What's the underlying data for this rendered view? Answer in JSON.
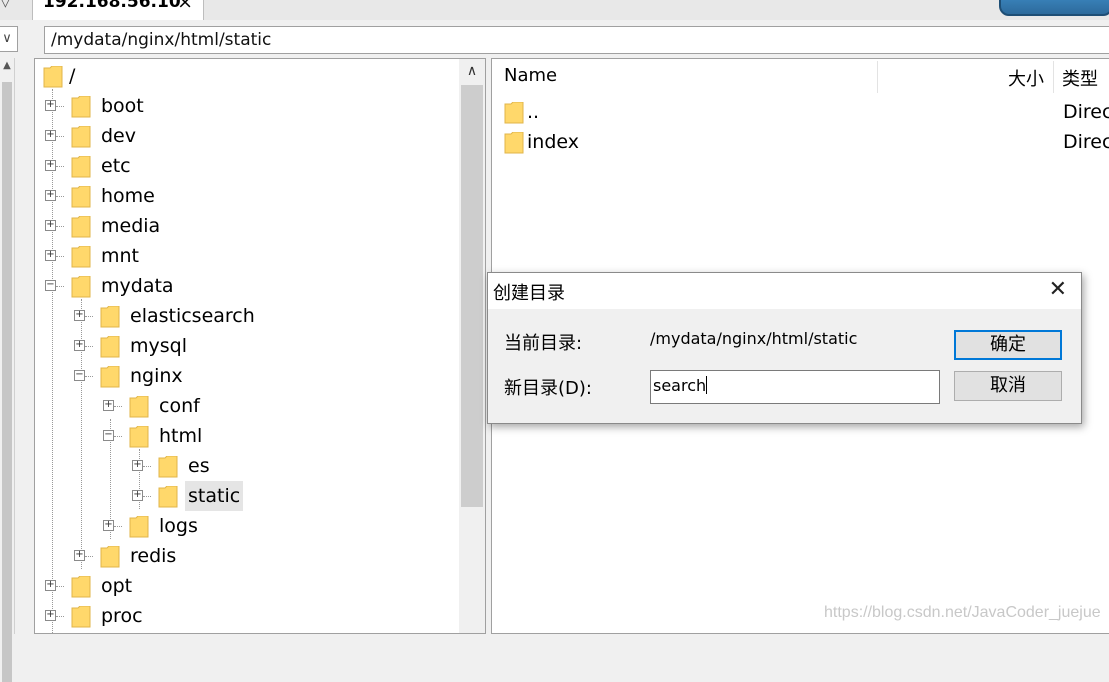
{
  "tab": {
    "title": "192.168.56.10",
    "close_label": "×"
  },
  "address_bar": {
    "path": "/mydata/nginx/html/static"
  },
  "tree": {
    "root_label": "/",
    "items": [
      {
        "label": "boot"
      },
      {
        "label": "dev"
      },
      {
        "label": "etc"
      },
      {
        "label": "home"
      },
      {
        "label": "media"
      },
      {
        "label": "mnt"
      },
      {
        "label": "mydata"
      },
      {
        "label": "elasticsearch"
      },
      {
        "label": "mysql"
      },
      {
        "label": "nginx"
      },
      {
        "label": "conf"
      },
      {
        "label": "html"
      },
      {
        "label": "es"
      },
      {
        "label": "static"
      },
      {
        "label": "logs"
      },
      {
        "label": "redis"
      },
      {
        "label": "opt"
      },
      {
        "label": "proc"
      }
    ],
    "selected": "static"
  },
  "file_list": {
    "columns": {
      "name": "Name",
      "size": "大小",
      "type": "类型"
    },
    "rows": [
      {
        "name": "..",
        "type": "Direc"
      },
      {
        "name": "index",
        "type": "Direc"
      }
    ]
  },
  "dialog": {
    "title": "创建目录",
    "current_dir_label": "当前目录:",
    "current_dir_value": "/mydata/nginx/html/static",
    "new_dir_label": "新目录(D):",
    "new_dir_value": "search",
    "ok_label": "确定",
    "cancel_label": "取消"
  },
  "watermark": "https://blog.csdn.net/JavaCoder_juejue",
  "colors": {
    "folder": "#ffd86b",
    "accent": "#0078d7"
  }
}
